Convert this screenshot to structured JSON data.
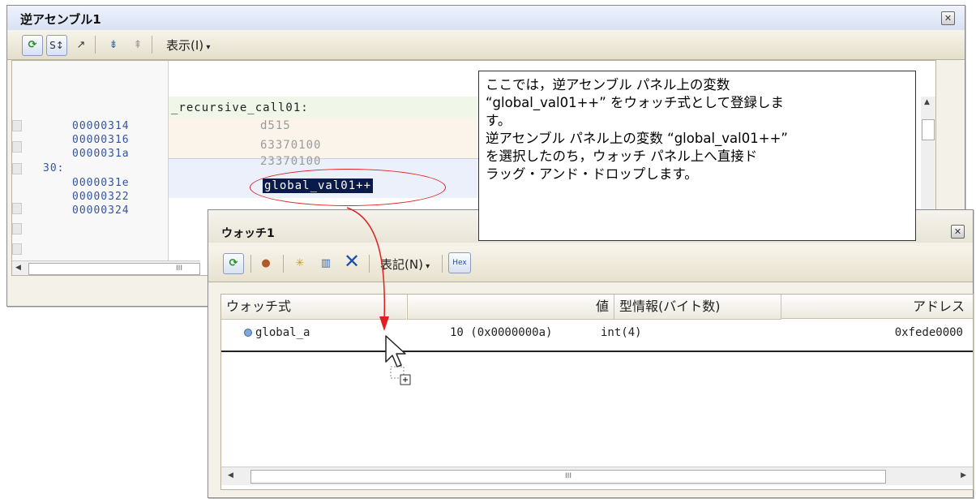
{
  "disasm_panel": {
    "title": "逆アセンブル1",
    "menu_display": "表示(I)",
    "label_recursive": "_recursive_call01:",
    "line_number": "30:",
    "addresses": [
      "00000314",
      "00000316",
      "0000031a",
      "0000031e",
      "00000322",
      "00000324"
    ],
    "code_lines": [
      "d515",
      "63370100",
      "23370100"
    ],
    "highlight_symbol": "global_val01++",
    "scroll_thumb": "III"
  },
  "callout": {
    "line1": "ここでは，逆アセンブル パネル上の変数",
    "line2": "“global_val01++” をウォッチ式として登録しま",
    "line3": "す。",
    "line4": "逆アセンブル パネル上の変数 “global_val01++”",
    "line5": "を選択したのち，ウォッチ パネル上へ直接ド",
    "line6": "ラッグ・アンド・ドロップします。"
  },
  "watch_panel": {
    "title": "ウォッチ1",
    "menu_notation": "表記(N)",
    "hex_button": "Hex",
    "columns": {
      "expr": "ウォッチ式",
      "value": "値",
      "type": "型情報(バイト数)",
      "address": "アドレス"
    },
    "row": {
      "expr": "global_a",
      "value": "10 (0x0000000a)",
      "type": "int(4)",
      "address": "0xfede0000"
    },
    "scroll_thumb": "III"
  },
  "colors": {
    "highlight_bg": "#0a1a4a",
    "callout_ellipse": "#e02020",
    "arrow": "#e02020"
  }
}
